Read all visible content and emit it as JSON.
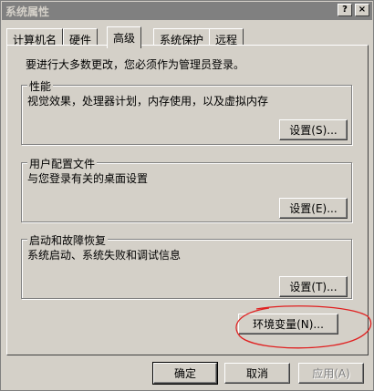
{
  "window": {
    "title": "系统属性",
    "help_glyph": "?",
    "close_glyph": "×"
  },
  "tabs": [
    {
      "label": "计算机名"
    },
    {
      "label": "硬件"
    },
    {
      "label": "高级",
      "active": true
    },
    {
      "label": "系统保护"
    },
    {
      "label": "远程"
    }
  ],
  "panel": {
    "intro": "要进行大多数更改，您必须作为管理员登录。",
    "performance": {
      "legend": "性能",
      "description": "视觉效果，处理器计划，内存使用，以及虚拟内存",
      "button": "设置(S)..."
    },
    "user_profiles": {
      "legend": "用户配置文件",
      "description": "与您登录有关的桌面设置",
      "button": "设置(E)..."
    },
    "startup_recovery": {
      "legend": "启动和故障恢复",
      "description": "系统启动、系统失败和调试信息",
      "button": "设置(T)..."
    },
    "env_button": "环境变量(N)...",
    "annotation_color": "#e02020"
  },
  "footer": {
    "ok": "确定",
    "cancel": "取消",
    "apply": "应用(A)"
  },
  "colors": {
    "face": "#d4d0c8",
    "titlebar": "#808080"
  }
}
